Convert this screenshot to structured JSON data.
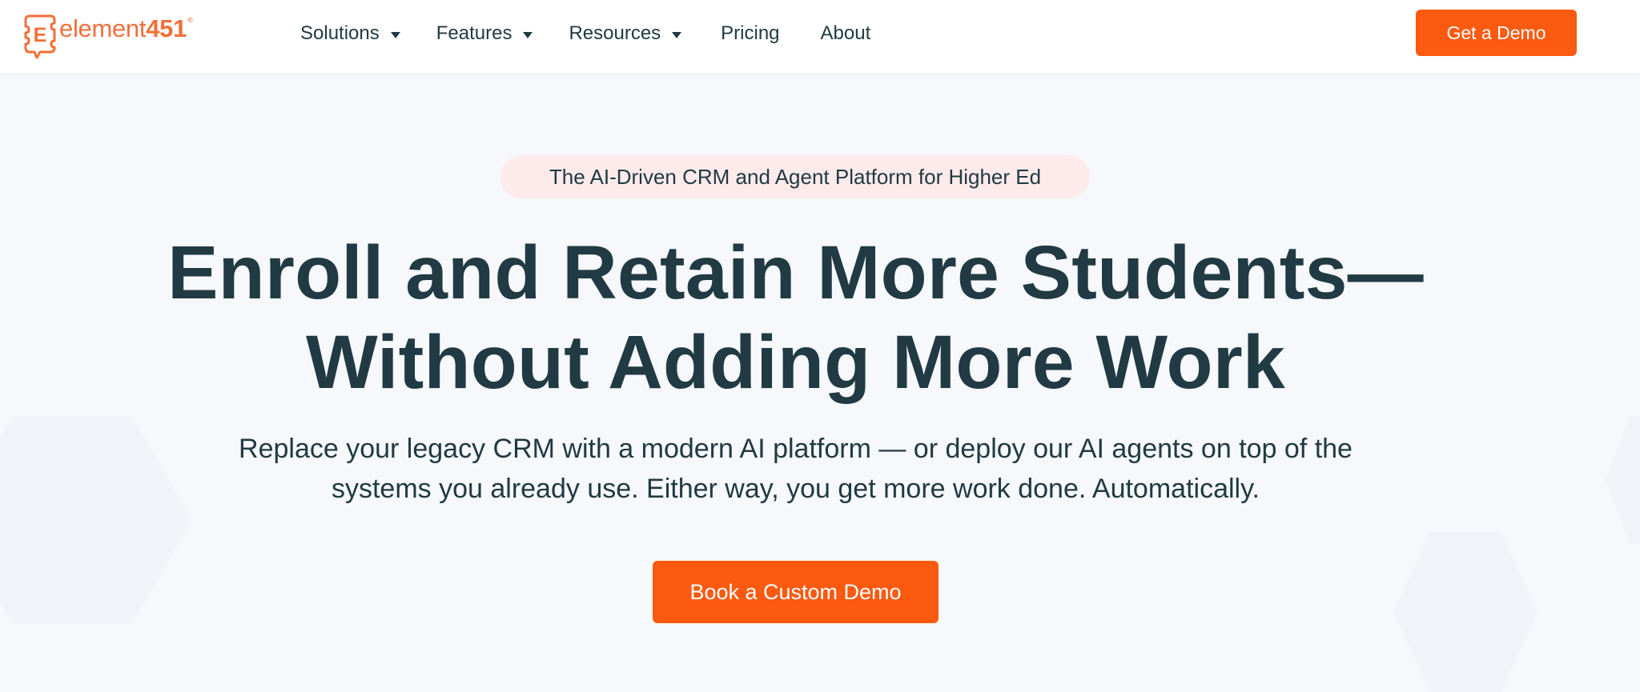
{
  "brand": {
    "logo_text": "element",
    "logo_number": "451",
    "logo_mark_letter": "E",
    "trademark": "®",
    "color": "#f0703a"
  },
  "nav": {
    "items": [
      {
        "label": "Solutions",
        "has_dropdown": true
      },
      {
        "label": "Features",
        "has_dropdown": true
      },
      {
        "label": "Resources",
        "has_dropdown": true
      },
      {
        "label": "Pricing",
        "has_dropdown": false
      },
      {
        "label": "About",
        "has_dropdown": false
      }
    ],
    "cta_label": "Get a Demo"
  },
  "hero": {
    "eyebrow": "The AI-Driven CRM and Agent Platform for Higher Ed",
    "headline_line1": "Enroll and Retain More Students—",
    "headline_line2": "Without Adding More Work",
    "subhead_line1": "Replace your legacy CRM with a modern AI platform — or deploy our AI agents on top of the",
    "subhead_line2": "systems you already use. Either way, you get more work done. Automatically.",
    "cta_label": "Book a Custom Demo"
  },
  "colors": {
    "accent": "#fc5a10",
    "text": "#213a43",
    "eyebrow_bg": "#fdeaea",
    "page_bg": "#f6f8fb"
  },
  "icons": {
    "dropdown": "caret-down-icon",
    "logo": "element451-logo-icon"
  }
}
